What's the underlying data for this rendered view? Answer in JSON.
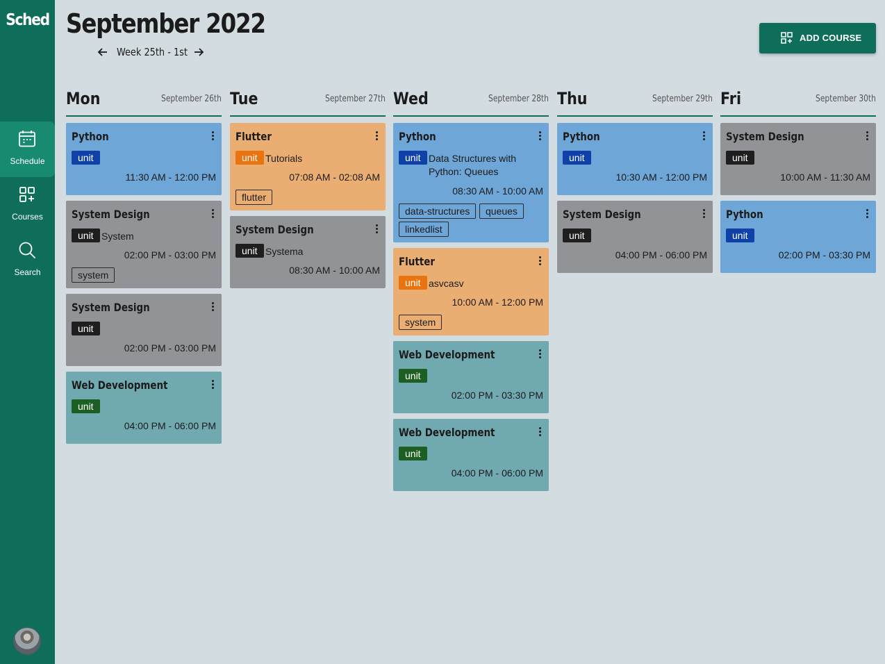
{
  "app": {
    "logo": "Sched"
  },
  "sidebar": {
    "items": [
      {
        "label": "Schedule",
        "icon": "calendar-icon",
        "active": true
      },
      {
        "label": "Courses",
        "icon": "grid-plus-icon",
        "active": false
      },
      {
        "label": "Search",
        "icon": "search-icon",
        "active": false
      }
    ]
  },
  "header": {
    "title": "September 2022",
    "week_label": "Week 25th - 1st",
    "add_course_label": "ADD COURSE"
  },
  "colors": {
    "primary": "#0f6e5a",
    "background": "#d3dce1",
    "card_blue": "#6ea6d8",
    "card_gray": "#919396",
    "card_orange": "#ebae72",
    "card_teal": "#70a9b0"
  },
  "days": [
    {
      "name": "Mon",
      "date": "September 26th",
      "cards": [
        {
          "title": "Python",
          "badge": "unit",
          "time": "11:30 AM - 12:00 PM"
        },
        {
          "title": "System Design",
          "badge": "unit",
          "desc": "System",
          "time": "02:00 PM - 03:00 PM",
          "tags": [
            "system"
          ]
        },
        {
          "title": "System Design",
          "badge": "unit",
          "time": "02:00 PM - 03:00 PM"
        },
        {
          "title": "Web Development",
          "badge": "unit",
          "time": "04:00 PM - 06:00 PM"
        }
      ]
    },
    {
      "name": "Tue",
      "date": "September 27th",
      "cards": [
        {
          "title": "Flutter",
          "badge": "unit",
          "desc": "Tutorials",
          "time": "07:08 AM - 02:08 AM",
          "tags": [
            "flutter"
          ]
        },
        {
          "title": "System Design",
          "badge": "unit",
          "desc": "Systema",
          "time": "08:30 AM - 10:00 AM"
        }
      ]
    },
    {
      "name": "Wed",
      "date": "September 28th",
      "cards": [
        {
          "title": "Python",
          "badge": "unit",
          "desc_line1": "Data Structures with",
          "desc_line2": "Python: Queues",
          "time": "08:30 AM - 10:00 AM",
          "tags": [
            "data-structures",
            "queues",
            "linkedlist"
          ]
        },
        {
          "title": "Flutter",
          "badge": "unit",
          "desc": "asvcasv",
          "time": "10:00 AM - 12:00 PM",
          "tags": [
            "system"
          ]
        },
        {
          "title": "Web Development",
          "badge": "unit",
          "time": "02:00 PM - 03:30 PM"
        },
        {
          "title": "Web Development",
          "badge": "unit",
          "time": "04:00 PM - 06:00 PM"
        }
      ]
    },
    {
      "name": "Thu",
      "date": "September 29th",
      "cards": [
        {
          "title": "Python",
          "badge": "unit",
          "time": "10:30 AM - 12:00 PM"
        },
        {
          "title": "System Design",
          "badge": "unit",
          "time": "04:00 PM - 06:00 PM"
        }
      ]
    },
    {
      "name": "Fri",
      "date": "September 30th",
      "cards": [
        {
          "title": "System Design",
          "badge": "unit",
          "time": "10:00 AM - 11:30 AM"
        },
        {
          "title": "Python",
          "badge": "unit",
          "time": "02:00 PM - 03:30 PM"
        }
      ]
    }
  ]
}
